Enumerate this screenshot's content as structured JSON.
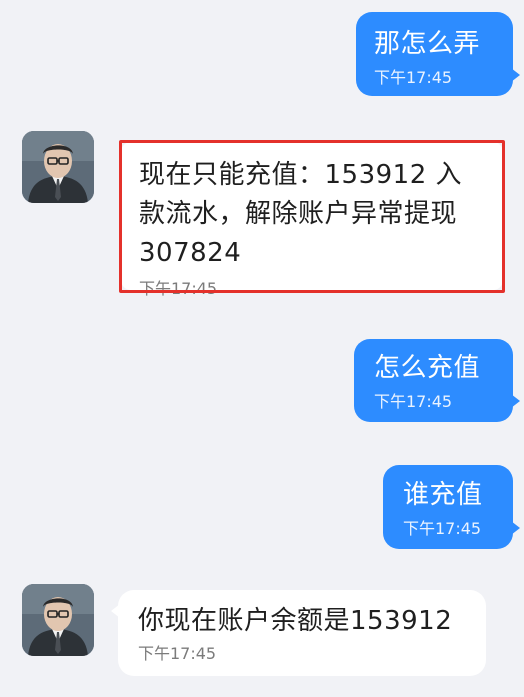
{
  "messages": [
    {
      "sender": "me",
      "text": "那怎么弄",
      "time": "下午17:45"
    },
    {
      "sender": "contact",
      "text": "现在只能充值：153912 入款流水，解除账户异常提现307824",
      "time": "下午17:45",
      "highlighted": true
    },
    {
      "sender": "me",
      "text": "怎么充值",
      "time": "下午17:45"
    },
    {
      "sender": "me",
      "text": "谁充值",
      "time": "下午17:45"
    },
    {
      "sender": "contact",
      "text": "你现在账户余额是153912",
      "time": "下午17:45"
    }
  ],
  "colors": {
    "outgoing_bubble": "#2d8cff",
    "incoming_bubble": "#ffffff",
    "highlight_border": "#e4312b",
    "background": "#f1f2f6"
  },
  "icons": {
    "avatar": "contact-avatar-icon"
  }
}
